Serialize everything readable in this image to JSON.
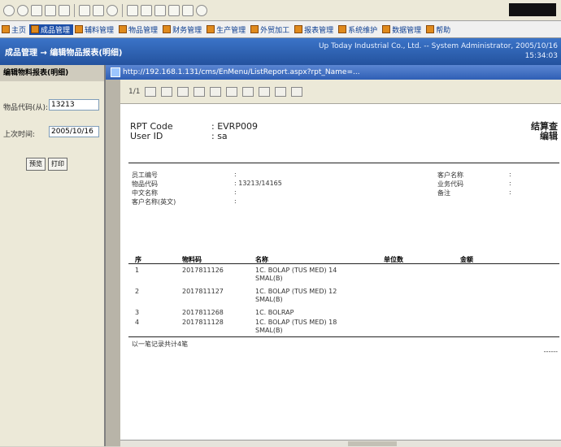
{
  "browser": {
    "url": "http://192.168.1.131/cms/EnMenu/ListReport.aspx?rpt_Name=..."
  },
  "navbar": {
    "items": [
      {
        "label": "主页",
        "active": false
      },
      {
        "label": "成品管理",
        "active": true
      },
      {
        "label": "辅料管理",
        "active": false
      },
      {
        "label": "物品管理",
        "active": false
      },
      {
        "label": "财务管理",
        "active": false
      },
      {
        "label": "生产管理",
        "active": false
      },
      {
        "label": "外贸加工",
        "active": false
      },
      {
        "label": "报表管理",
        "active": false
      },
      {
        "label": "系统维护",
        "active": false
      },
      {
        "label": "数据管理",
        "active": false
      },
      {
        "label": "帮助",
        "active": false
      }
    ]
  },
  "header": {
    "left": "成品管理  → 编辑物品报表(明细)",
    "company": "Up Today Industrial Co., Ltd. -- System Administrator, 2005/10/16",
    "time": "15:34:03"
  },
  "sidebar": {
    "title": "编辑物料报表(明细)",
    "field1_label": "物品代码(从):",
    "field1_value": "13213",
    "field2_label": "上次时间:",
    "field2_value": "2005/10/16",
    "btn_preview": "预览",
    "btn_print": "打印"
  },
  "viewer": {
    "page_label": "1/1"
  },
  "report": {
    "rpt_code_label": "RPT Code",
    "rpt_code_value": ": EVRP009",
    "user_id_label": "User ID",
    "user_id_value": ": sa",
    "title_line1": "结算查",
    "title_line2": "编辑",
    "fields_left": [
      {
        "label": "员工编号",
        "value": ":"
      },
      {
        "label": "物品代码",
        "value": ": 13213/14165"
      },
      {
        "label": "中文名称",
        "value": ":"
      },
      {
        "label": "客户名称(英文)",
        "value": ":"
      }
    ],
    "fields_right": [
      {
        "label": "客户名称",
        "value": ":"
      },
      {
        "label": "业务代码",
        "value": ":"
      },
      {
        "label": "备注",
        "value": ":"
      }
    ],
    "columns": [
      "序",
      "物料码",
      "名称",
      "单位数",
      "金额"
    ],
    "rows": [
      {
        "no": "1",
        "code": "2017811126",
        "desc": "1C. BOLAP (TUS MED) 14 SMAL(B)"
      },
      {
        "no": "2",
        "code": "2017811127",
        "desc": "1C. BOLAP (TUS MED) 12 SMAL(B)"
      },
      {
        "no": "3",
        "code": "2017811268",
        "desc": "1C. BOLRAP"
      },
      {
        "no": "4",
        "code": "2017811128",
        "desc": "1C. BOLAP (TUS MED) 18 SMAL(B)"
      }
    ],
    "footer": "以一笔记录共计4笔",
    "page_dashes": "------"
  },
  "colors": {
    "header_bg": "#24529e",
    "nav_active": "#1d4fa8",
    "url_bar": "#2f5fb5"
  }
}
